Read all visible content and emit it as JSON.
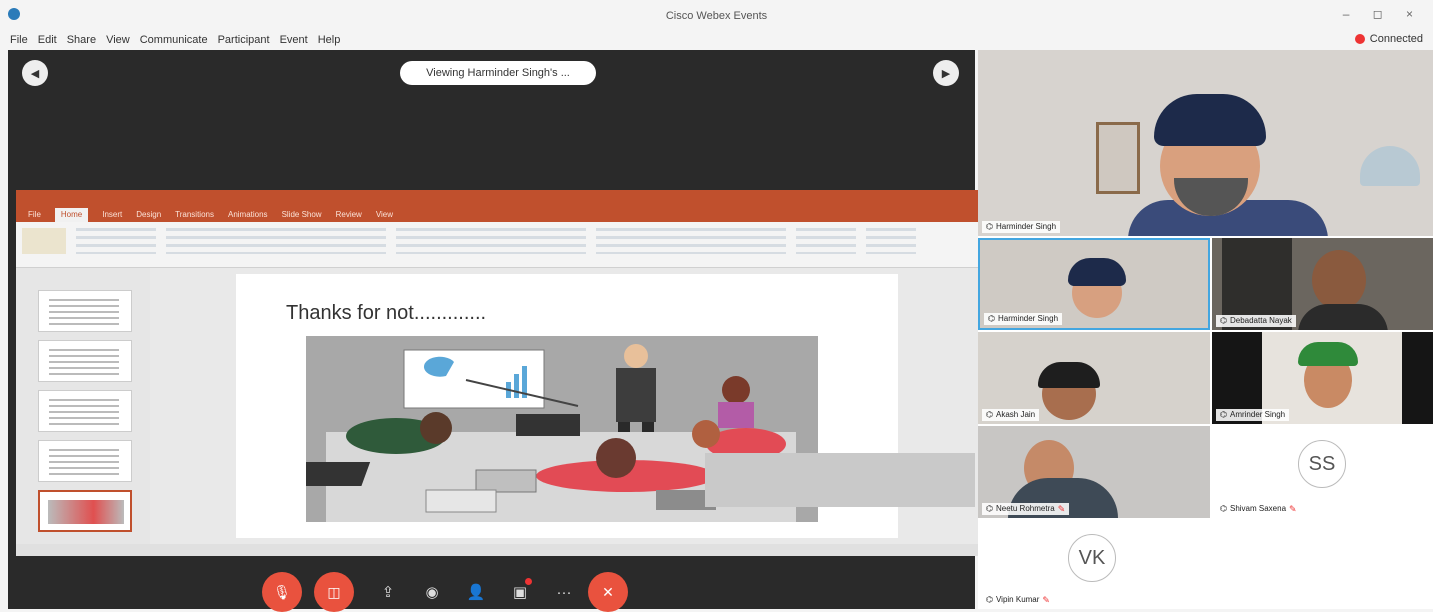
{
  "window": {
    "title": "Cisco Webex Events",
    "controls": "– ◻ ×"
  },
  "menu": {
    "items": [
      "File",
      "Edit",
      "Share",
      "View",
      "Communicate",
      "Participant",
      "Event",
      "Help"
    ],
    "status": "Connected"
  },
  "share": {
    "viewing_label": "Viewing Harminder Singh's ...",
    "left_btn": "◀",
    "right_btn": "▶"
  },
  "ppt": {
    "tabs": [
      "File",
      "Home",
      "Insert",
      "Design",
      "Transitions",
      "Animations",
      "Slide Show",
      "Review",
      "View"
    ],
    "active_tab": "Home",
    "slide": {
      "title": "Thanks for not............."
    }
  },
  "controls": {
    "mute_icon": "mic-off-icon",
    "video_icon": "video-off-icon",
    "share_icon": "share-icon",
    "record_icon": "record-icon",
    "participants_icon": "participants-icon",
    "chat_icon": "chat-icon",
    "more_icon": "more-icon",
    "end_icon": "end-call-icon",
    "glyphs": {
      "mute": "🎙",
      "video": "◫",
      "share": "⇪",
      "record": "◉",
      "participants": "👤",
      "chat": "▣",
      "more": "···",
      "end": "✕"
    }
  },
  "participants": [
    {
      "name": "Harminder Singh",
      "tile": "main"
    },
    {
      "name": "Harminder Singh",
      "tile": "grid"
    },
    {
      "name": "Debadatta Nayak",
      "tile": "grid"
    },
    {
      "name": "Akash Jain",
      "tile": "grid"
    },
    {
      "name": "Amrinder Singh",
      "tile": "grid"
    },
    {
      "name": "Neetu Rohmetra",
      "tile": "grid",
      "muted": true
    },
    {
      "name": "Shivam Saxena",
      "tile": "avatar",
      "initials": "SS",
      "muted": true
    },
    {
      "name": "Vipin Kumar",
      "tile": "avatar",
      "initials": "VK",
      "muted": true
    }
  ]
}
